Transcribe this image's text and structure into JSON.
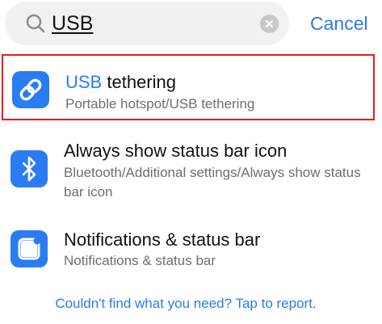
{
  "search": {
    "query": "USB",
    "cancel_label": "Cancel"
  },
  "results": [
    {
      "title_highlight": "USB",
      "title_rest": " tethering",
      "subtitle": "Portable hotspot/USB tethering",
      "icon": "link-icon"
    },
    {
      "title": "Always show status bar icon",
      "subtitle": "Bluetooth/Additional settings/Always show status bar icon",
      "icon": "bluetooth-icon"
    },
    {
      "title": "Notifications & status bar",
      "subtitle": "Notifications & status bar",
      "icon": "notification-icon"
    }
  ],
  "footer": {
    "report_link": "Couldn't find what you need? Tap to report."
  },
  "colors": {
    "accent": "#2d7be5",
    "icon_bg": "#2a7cf2",
    "highlight_border": "#e11d1d",
    "search_bg": "#f1f1f3"
  }
}
